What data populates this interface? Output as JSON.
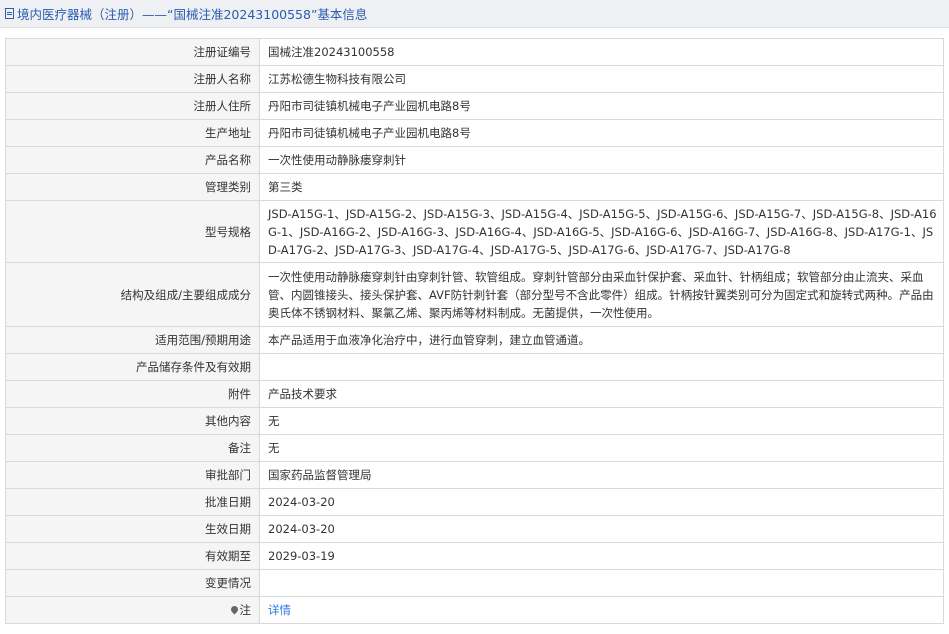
{
  "header": {
    "title": "境内医疗器械（注册）——“国械注准20243100558”基本信息",
    "icon": "document-icon"
  },
  "rows": [
    {
      "label": "注册证编号",
      "value": "国械注准20243100558"
    },
    {
      "label": "注册人名称",
      "value": "江苏松德生物科技有限公司"
    },
    {
      "label": "注册人住所",
      "value": "丹阳市司徒镇机械电子产业园机电路8号"
    },
    {
      "label": "生产地址",
      "value": "丹阳市司徒镇机械电子产业园机电路8号"
    },
    {
      "label": "产品名称",
      "value": "一次性使用动静脉瘘穿刺针"
    },
    {
      "label": "管理类别",
      "value": "第三类"
    },
    {
      "label": "型号规格",
      "value": "JSD-A15G-1、JSD-A15G-2、JSD-A15G-3、JSD-A15G-4、JSD-A15G-5、JSD-A15G-6、JSD-A15G-7、JSD-A15G-8、JSD-A16G-1、JSD-A16G-2、JSD-A16G-3、JSD-A16G-4、JSD-A16G-5、JSD-A16G-6、JSD-A16G-7、JSD-A16G-8、JSD-A17G-1、JSD-A17G-2、JSD-A17G-3、JSD-A17G-4、JSD-A17G-5、JSD-A17G-6、JSD-A17G-7、JSD-A17G-8"
    },
    {
      "label": "结构及组成/主要组成成分",
      "value": "一次性使用动静脉瘘穿刺针由穿刺针管、软管组成。穿刺针管部分由采血针保护套、采血针、针柄组成；软管部分由止流夹、采血管、内圆锥接头、接头保护套、AVF防针刺针套（部分型号不含此零件）组成。针柄按针翼类别可分为固定式和旋转式两种。产品由奥氏体不锈钢材料、聚氯乙烯、聚丙烯等材料制成。无菌提供，一次性使用。"
    },
    {
      "label": "适用范围/预期用途",
      "value": "本产品适用于血液净化治疗中，进行血管穿刺，建立血管通道。"
    },
    {
      "label": "产品储存条件及有效期",
      "value": ""
    },
    {
      "label": "附件",
      "value": "产品技术要求"
    },
    {
      "label": "其他内容",
      "value": "无"
    },
    {
      "label": "备注",
      "value": "无"
    },
    {
      "label": "审批部门",
      "value": "国家药品监督管理局"
    },
    {
      "label": "批准日期",
      "value": "2024-03-20"
    },
    {
      "label": "生效日期",
      "value": "2024-03-20"
    },
    {
      "label": "有效期至",
      "value": "2029-03-19"
    },
    {
      "label": "变更情况",
      "value": ""
    },
    {
      "label": "注",
      "value": "详情",
      "icon": "pin-icon"
    }
  ]
}
